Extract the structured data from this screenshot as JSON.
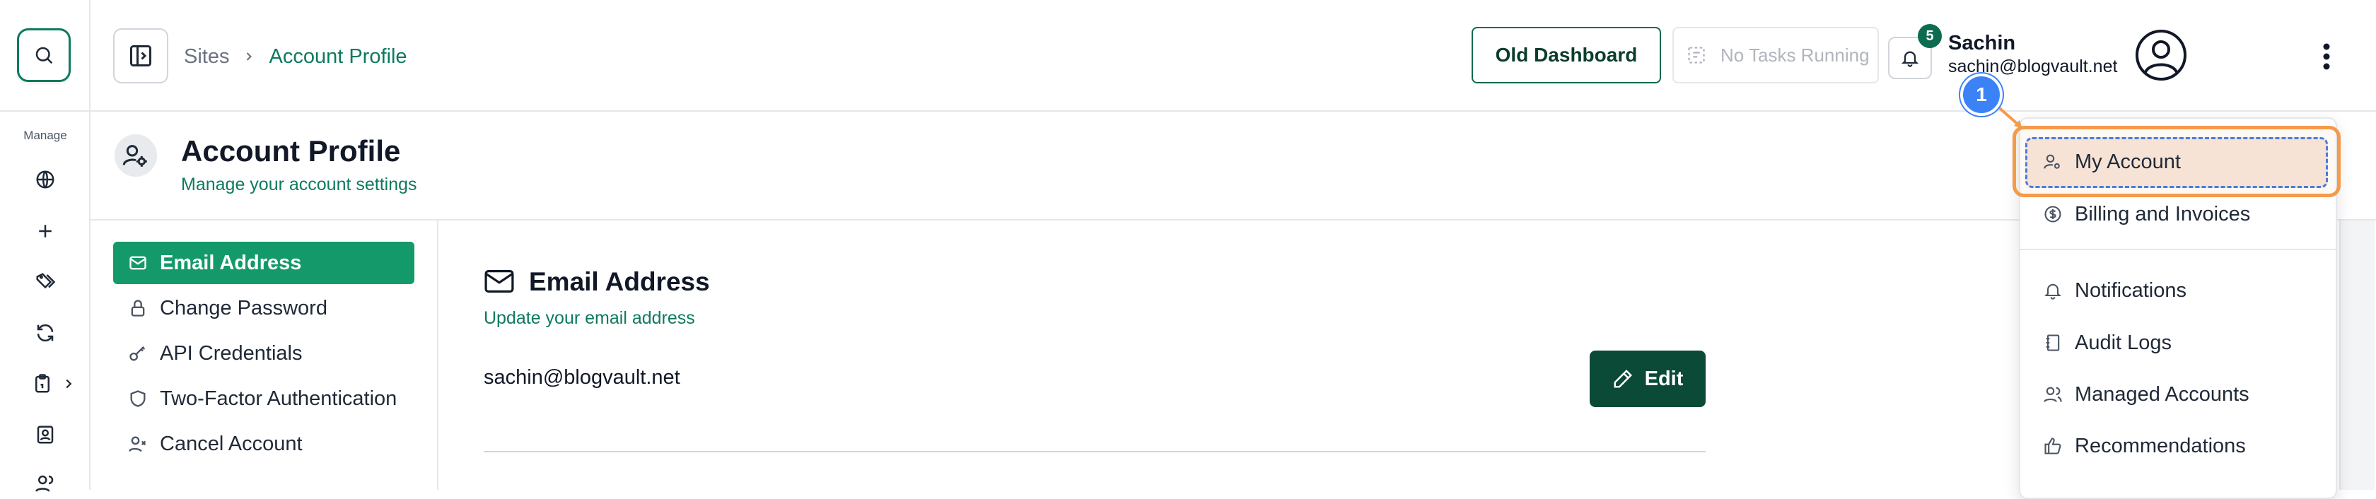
{
  "rail": {
    "section_label": "Manage",
    "icons": [
      "globe-icon",
      "plus-icon",
      "tags-icon",
      "refresh-icon",
      "clipboard-icon",
      "contact-card-icon",
      "users-icon"
    ]
  },
  "header": {
    "breadcrumb": {
      "root": "Sites",
      "current": "Account Profile"
    },
    "old_dashboard_label": "Old Dashboard",
    "tasks_label": "No Tasks Running",
    "notifications_count": "5",
    "user_name": "Sachin",
    "user_email": "sachin@blogvault.net"
  },
  "profile": {
    "title": "Account Profile",
    "subtitle": "Manage your account settings"
  },
  "settings_nav": {
    "items": [
      {
        "label": "Email Address",
        "icon": "mail-icon",
        "active": true
      },
      {
        "label": "Change Password",
        "icon": "lock-icon",
        "active": false
      },
      {
        "label": "API Credentials",
        "icon": "key-icon",
        "active": false
      },
      {
        "label": "Two-Factor Authentication",
        "icon": "shield-icon",
        "active": false
      },
      {
        "label": "Cancel Account",
        "icon": "user-x-icon",
        "active": false
      }
    ]
  },
  "email_section": {
    "title": "Email Address",
    "subtitle": "Update your email address",
    "value": "sachin@blogvault.net",
    "edit_label": "Edit"
  },
  "dropdown": {
    "items": [
      {
        "label": "My Account",
        "icon": "user-cog-icon"
      },
      {
        "label": "Billing and Invoices",
        "icon": "dollar-circle-icon"
      },
      {
        "label": "Notifications",
        "icon": "bell-icon"
      },
      {
        "label": "Audit Logs",
        "icon": "notebook-icon"
      },
      {
        "label": "Managed Accounts",
        "icon": "users-icon"
      },
      {
        "label": "Recommendations",
        "icon": "thumbs-up-icon"
      }
    ]
  },
  "annotation": {
    "step": "1"
  },
  "colors": {
    "brand_green": "#0d7a5f",
    "active_green": "#149a6a",
    "edit_button": "#0b4a37",
    "highlight_orange": "#f59a4a",
    "step_blue": "#3b82f6"
  }
}
